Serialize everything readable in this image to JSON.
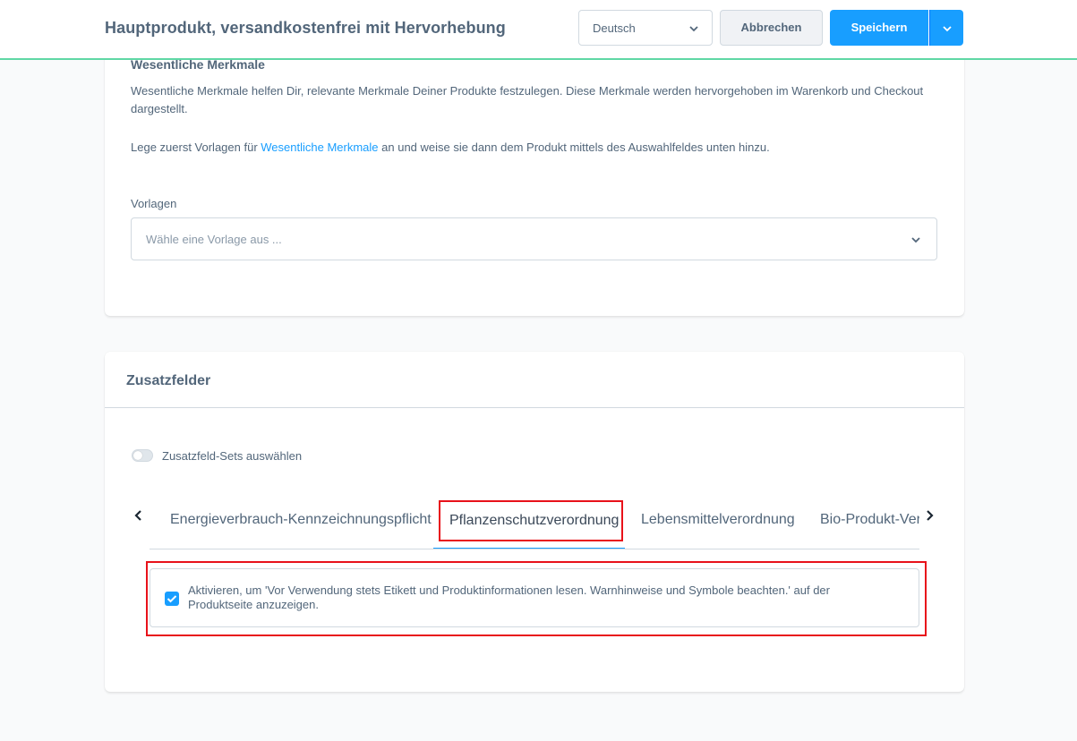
{
  "header": {
    "title": "Hauptprodukt, versandkostenfrei mit Hervorhebung",
    "language": "Deutsch",
    "cancel_label": "Abbrechen",
    "save_label": "Speichern"
  },
  "features_card": {
    "title": "Wesentliche Merkmale",
    "description": "Wesentliche Merkmale helfen Dir, relevante Merkmale Deiner Produkte festzulegen. Diese Merkmale werden hervorgehoben im Warenkorb und Checkout dargestellt.",
    "hint_prefix": "Lege zuerst Vorlagen für ",
    "hint_link": "Wesentliche Merkmale",
    "hint_suffix": " an und weise sie dann dem Produkt mittels des Auswahlfeldes unten hinzu.",
    "templates_label": "Vorlagen",
    "templates_placeholder": "Wähle eine Vorlage aus ..."
  },
  "custom_fields_card": {
    "title": "Zusatzfelder",
    "toggle_label": "Zusatzfeld-Sets auswählen",
    "toggle_on": false,
    "tabs": [
      {
        "label": "Energieverbrauch-Kennzeichnungspflicht"
      },
      {
        "label": "Pflanzenschutzverordnung",
        "active": true
      },
      {
        "label": "Lebensmittelverordnung"
      },
      {
        "label": "Bio-Produkt-Verordnung"
      }
    ],
    "checkbox_checked": true,
    "checkbox_label": "Aktivieren, um 'Vor Verwendung stets Etikett und Produktinformationen lesen. Warnhinweise und Symbole beachten.' auf der Produktseite anzuzeigen."
  },
  "colors": {
    "accent": "#189eff",
    "highlight": "#e8121a",
    "topbar_border": "#5fd7a5"
  }
}
